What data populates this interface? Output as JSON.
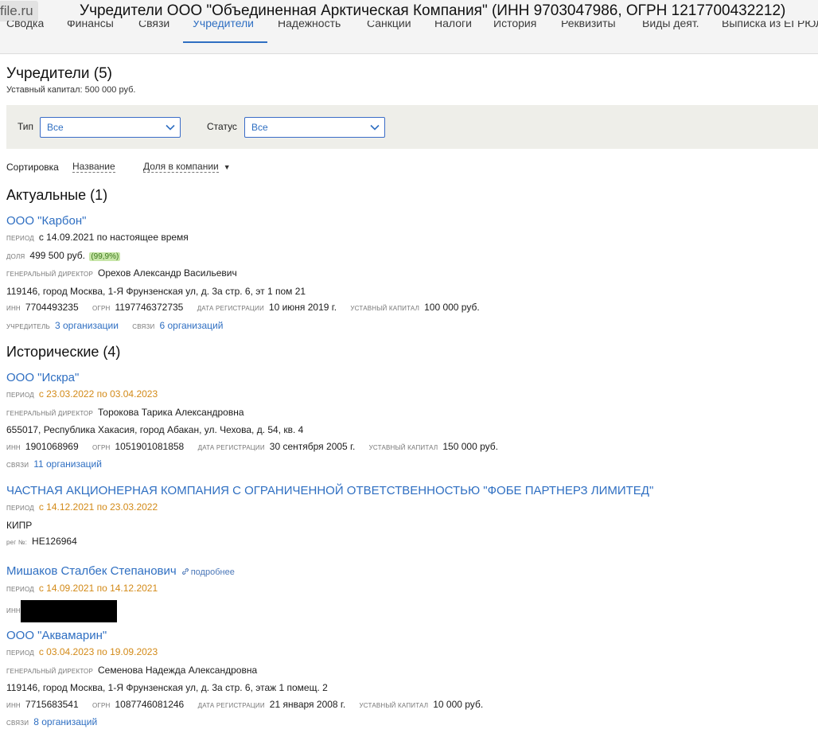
{
  "window": {
    "logo": "file.ru",
    "title": "Учредители ООО \"Объединенная Арктическая Компания\" (ИНН 9703047986, ОГРН 1217700432212)"
  },
  "tabs": [
    {
      "label": "Сводка"
    },
    {
      "label": "Финансы"
    },
    {
      "label": "Связи"
    },
    {
      "label": "Учредители",
      "active": true
    },
    {
      "label": "Надежность"
    },
    {
      "label": "Санкции"
    },
    {
      "label": "Налоги"
    },
    {
      "label": "История"
    },
    {
      "label": "Реквизиты"
    },
    {
      "label": "Виды деят."
    },
    {
      "label": "Выписка из ЕГРЮЛ"
    }
  ],
  "page": {
    "heading": "Учредители (5)",
    "capital": "Уставный капитал: 500 000 руб."
  },
  "filters": {
    "type_label": "Тип",
    "type_value": "Все",
    "status_label": "Статус",
    "status_value": "Все"
  },
  "sort": {
    "label": "Сортировка",
    "by_name": "Название",
    "by_share": "Доля в компании",
    "arrow": "▼"
  },
  "labels": {
    "period": "период",
    "share": "доля",
    "director": "генеральный директор",
    "inn": "ИНН",
    "ogrn": "ОГРН",
    "reg_date": "дата регистрации",
    "capital": "уставный капитал",
    "founder": "учредитель",
    "links": "связи",
    "reg_no": "рег №:",
    "more": "подробнее"
  },
  "sections": {
    "current": "Актуальные (1)",
    "historical": "Исторические (4)"
  },
  "current": {
    "name": "ООО \"Карбон\"",
    "period": "с 14.09.2021 по настоящее время",
    "share": "499 500 руб.",
    "share_pct": "(99,9%)",
    "director": "Орехов Александр Васильевич",
    "address": "119146, город Москва, 1-Я Фрунзенская ул, д. 3а стр. 6, эт 1 пом 21",
    "inn": "7704493235",
    "ogrn": "1197746372735",
    "reg_date": "10 июня 2019 г.",
    "capital": "100 000 руб.",
    "founder_of": "3 организации",
    "links": "6 организаций"
  },
  "historical": [
    {
      "name": "ООО \"Искра\"",
      "period": "с 23.03.2022 по 03.04.2023",
      "director": "Торокова Тарика Александровна",
      "address": "655017, Республика Хакасия, город Абакан, ул. Чехова, д. 54, кв. 4",
      "inn": "1901068969",
      "ogrn": "1051901081858",
      "reg_date": "30 сентября 2005 г.",
      "capital": "150 000 руб.",
      "links": "11 организаций"
    },
    {
      "name": "ЧАСТНАЯ АКЦИОНЕРНАЯ КОМПАНИЯ С ОГРАНИЧЕННОЙ ОТВЕТСТВЕННОСТЬЮ \"ФОБЕ ПАРТНЕРЗ ЛИМИТЕД\"",
      "period": "с 14.12.2021 по 23.03.2022",
      "country": "КИПР",
      "reg_no": "HE126964"
    },
    {
      "name": "Мишаков Сталбек Степанович",
      "period": "с 14.09.2021 по 14.12.2021"
    },
    {
      "name": "ООО \"Аквамарин\"",
      "period": "с 03.04.2023 по 19.09.2023",
      "director": "Семенова Надежда Александровна",
      "address": "119146, город Москва, 1-Я Фрунзенская ул, д. 3а стр. 6, этаж 1 помещ. 2",
      "inn": "7715683541",
      "ogrn": "1087746081246",
      "reg_date": "21 января 2008 г.",
      "capital": "10 000 руб.",
      "links": "8 организаций"
    }
  ]
}
